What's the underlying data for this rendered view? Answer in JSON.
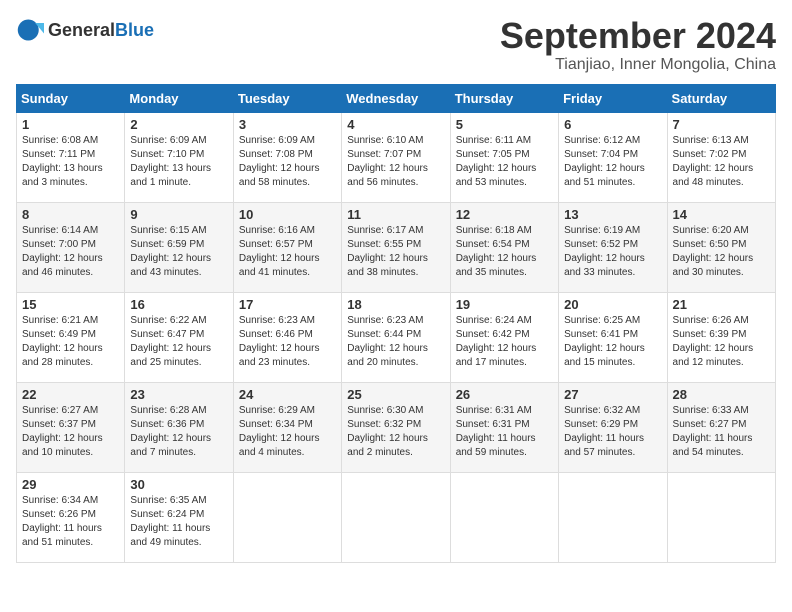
{
  "header": {
    "logo_general": "General",
    "logo_blue": "Blue",
    "month": "September 2024",
    "location": "Tianjiao, Inner Mongolia, China"
  },
  "weekdays": [
    "Sunday",
    "Monday",
    "Tuesday",
    "Wednesday",
    "Thursday",
    "Friday",
    "Saturday"
  ],
  "weeks": [
    [
      {
        "day": "1",
        "sunrise": "6:08 AM",
        "sunset": "7:11 PM",
        "daylight": "13 hours and 3 minutes."
      },
      {
        "day": "2",
        "sunrise": "6:09 AM",
        "sunset": "7:10 PM",
        "daylight": "13 hours and 1 minute."
      },
      {
        "day": "3",
        "sunrise": "6:09 AM",
        "sunset": "7:08 PM",
        "daylight": "12 hours and 58 minutes."
      },
      {
        "day": "4",
        "sunrise": "6:10 AM",
        "sunset": "7:07 PM",
        "daylight": "12 hours and 56 minutes."
      },
      {
        "day": "5",
        "sunrise": "6:11 AM",
        "sunset": "7:05 PM",
        "daylight": "12 hours and 53 minutes."
      },
      {
        "day": "6",
        "sunrise": "6:12 AM",
        "sunset": "7:04 PM",
        "daylight": "12 hours and 51 minutes."
      },
      {
        "day": "7",
        "sunrise": "6:13 AM",
        "sunset": "7:02 PM",
        "daylight": "12 hours and 48 minutes."
      }
    ],
    [
      {
        "day": "8",
        "sunrise": "6:14 AM",
        "sunset": "7:00 PM",
        "daylight": "12 hours and 46 minutes."
      },
      {
        "day": "9",
        "sunrise": "6:15 AM",
        "sunset": "6:59 PM",
        "daylight": "12 hours and 43 minutes."
      },
      {
        "day": "10",
        "sunrise": "6:16 AM",
        "sunset": "6:57 PM",
        "daylight": "12 hours and 41 minutes."
      },
      {
        "day": "11",
        "sunrise": "6:17 AM",
        "sunset": "6:55 PM",
        "daylight": "12 hours and 38 minutes."
      },
      {
        "day": "12",
        "sunrise": "6:18 AM",
        "sunset": "6:54 PM",
        "daylight": "12 hours and 35 minutes."
      },
      {
        "day": "13",
        "sunrise": "6:19 AM",
        "sunset": "6:52 PM",
        "daylight": "12 hours and 33 minutes."
      },
      {
        "day": "14",
        "sunrise": "6:20 AM",
        "sunset": "6:50 PM",
        "daylight": "12 hours and 30 minutes."
      }
    ],
    [
      {
        "day": "15",
        "sunrise": "6:21 AM",
        "sunset": "6:49 PM",
        "daylight": "12 hours and 28 minutes."
      },
      {
        "day": "16",
        "sunrise": "6:22 AM",
        "sunset": "6:47 PM",
        "daylight": "12 hours and 25 minutes."
      },
      {
        "day": "17",
        "sunrise": "6:23 AM",
        "sunset": "6:46 PM",
        "daylight": "12 hours and 23 minutes."
      },
      {
        "day": "18",
        "sunrise": "6:23 AM",
        "sunset": "6:44 PM",
        "daylight": "12 hours and 20 minutes."
      },
      {
        "day": "19",
        "sunrise": "6:24 AM",
        "sunset": "6:42 PM",
        "daylight": "12 hours and 17 minutes."
      },
      {
        "day": "20",
        "sunrise": "6:25 AM",
        "sunset": "6:41 PM",
        "daylight": "12 hours and 15 minutes."
      },
      {
        "day": "21",
        "sunrise": "6:26 AM",
        "sunset": "6:39 PM",
        "daylight": "12 hours and 12 minutes."
      }
    ],
    [
      {
        "day": "22",
        "sunrise": "6:27 AM",
        "sunset": "6:37 PM",
        "daylight": "12 hours and 10 minutes."
      },
      {
        "day": "23",
        "sunrise": "6:28 AM",
        "sunset": "6:36 PM",
        "daylight": "12 hours and 7 minutes."
      },
      {
        "day": "24",
        "sunrise": "6:29 AM",
        "sunset": "6:34 PM",
        "daylight": "12 hours and 4 minutes."
      },
      {
        "day": "25",
        "sunrise": "6:30 AM",
        "sunset": "6:32 PM",
        "daylight": "12 hours and 2 minutes."
      },
      {
        "day": "26",
        "sunrise": "6:31 AM",
        "sunset": "6:31 PM",
        "daylight": "11 hours and 59 minutes."
      },
      {
        "day": "27",
        "sunrise": "6:32 AM",
        "sunset": "6:29 PM",
        "daylight": "11 hours and 57 minutes."
      },
      {
        "day": "28",
        "sunrise": "6:33 AM",
        "sunset": "6:27 PM",
        "daylight": "11 hours and 54 minutes."
      }
    ],
    [
      {
        "day": "29",
        "sunrise": "6:34 AM",
        "sunset": "6:26 PM",
        "daylight": "11 hours and 51 minutes."
      },
      {
        "day": "30",
        "sunrise": "6:35 AM",
        "sunset": "6:24 PM",
        "daylight": "11 hours and 49 minutes."
      },
      null,
      null,
      null,
      null,
      null
    ]
  ]
}
